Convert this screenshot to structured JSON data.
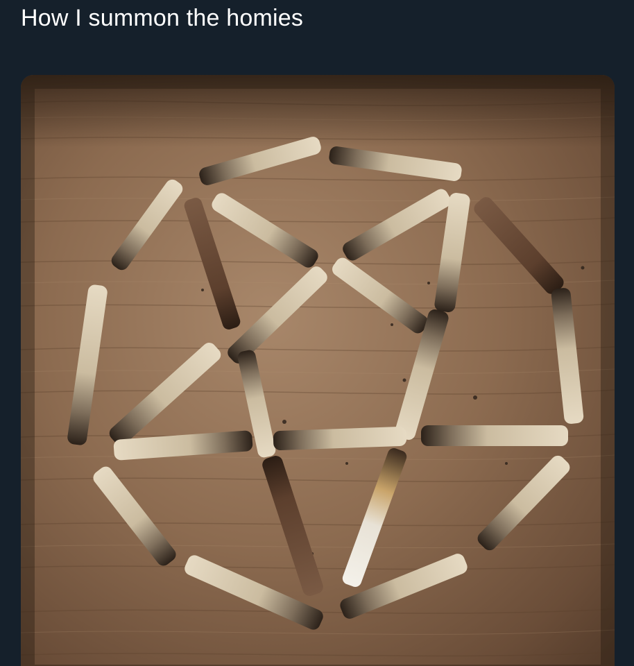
{
  "post": {
    "caption": "How I summon the homies",
    "background_color": "#15202b",
    "text_color": "#ffffff"
  },
  "photo": {
    "subject": "burnt joint stubs arranged in a pentagram inside a circle on a wooden table",
    "table_color": "#8a6a4e",
    "paper_color": "#e2d6bf",
    "ash_color": "#2a221c"
  }
}
